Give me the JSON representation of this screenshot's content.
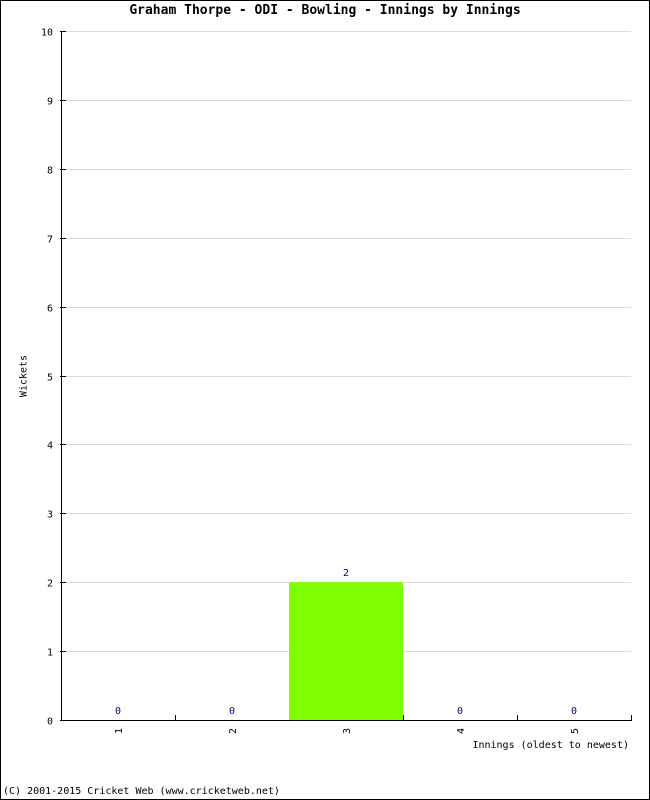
{
  "chart_data": {
    "type": "bar",
    "title": "Graham Thorpe - ODI - Bowling - Innings by Innings",
    "xlabel": "Innings (oldest to newest)",
    "ylabel": "Wickets",
    "categories": [
      "1",
      "2",
      "3",
      "4",
      "5"
    ],
    "values": [
      0,
      0,
      2,
      0,
      0
    ],
    "data_labels": [
      "0",
      "0",
      "2",
      "0",
      "0"
    ],
    "ylim": [
      0,
      10
    ],
    "yticks": [
      "0",
      "1",
      "2",
      "3",
      "4",
      "5",
      "6",
      "7",
      "8",
      "9",
      "10"
    ],
    "grid": true,
    "legend": "none",
    "bar_color": "#80ff00",
    "label_color": "#000080"
  },
  "footer": "(C) 2001-2015 Cricket Web (www.cricketweb.net)"
}
